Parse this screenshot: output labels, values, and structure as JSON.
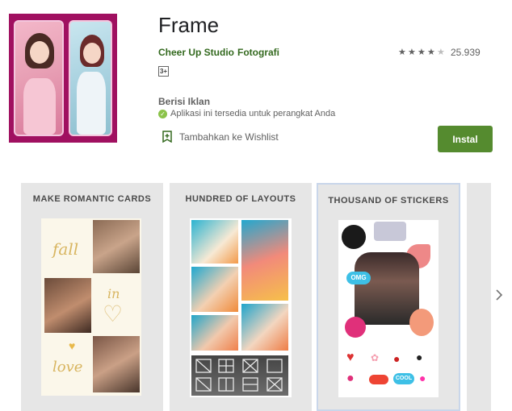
{
  "app": {
    "title": "Frame",
    "developer": "Cheer Up Studio",
    "category": "Fotografi",
    "rating_count": "25.939",
    "rating_value": 4.5,
    "content_rating": "3+",
    "ads_label": "Berisi Iklan",
    "availability": "Aplikasi ini tersedia untuk perangkat Anda",
    "wishlist_label": "Tambahkan ke Wishlist",
    "install_label": "Instal"
  },
  "screenshots": [
    {
      "caption": "MAKE ROMANTIC CARDS",
      "words": [
        "fall",
        "in",
        "love"
      ]
    },
    {
      "caption": "HUNDRED OF LAYOUTS"
    },
    {
      "caption": "THOUSAND OF STICKERS",
      "stickers": [
        "OMG",
        "COOL"
      ]
    }
  ],
  "colors": {
    "accent": "#558b2f",
    "link": "#33691e",
    "text_muted": "#616161"
  },
  "icons": {
    "wishlist": "bookmark-add-icon",
    "availability": "check-circle-icon",
    "next": "chevron-right-icon"
  }
}
